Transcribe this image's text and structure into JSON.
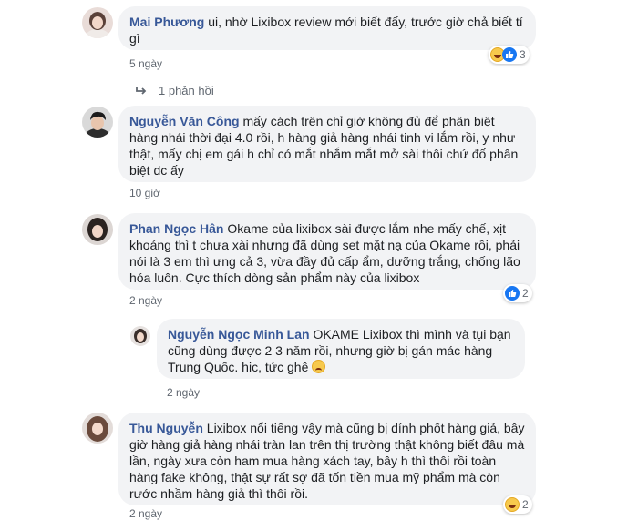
{
  "comments": [
    {
      "author": "Mai Phương",
      "text": "ui, nhờ Lixibox review mới biết đấy, trước giờ chả biết tí gì",
      "time": "5 ngày",
      "reaction_count": "3",
      "reactions": [
        "haha",
        "like"
      ]
    },
    {
      "author": "Nguyễn Văn Công",
      "text": "mấy cách trên chỉ giờ không đủ để phân biệt hàng nhái thời đại 4.0 rồi, h hàng giả hàng nhái tinh vi lắm rồi, y như thật, mấy chị em gái h chỉ có mắt nhắm mắt mở sài thôi chứ đố phân biệt dc ấy",
      "time": "10 giờ"
    },
    {
      "author": "Phan Ngọc Hân",
      "text": "Okame của lixibox sài được lắm nhe mấy chế, xịt khoáng thì t chưa xài nhưng đã dùng set mặt nạ của Okame rồi, phải nói là 3 em thì ưng cả 3, vừa đầy đủ cấp ẩm, dưỡng trắng, chống lão hóa luôn. Cực thích dòng sản phẩm này của lixibox",
      "time": "2 ngày",
      "reaction_count": "2",
      "reactions": [
        "like"
      ]
    },
    {
      "author": "Nguyễn Ngọc Minh Lan",
      "text": "OKAME Lixibox thì mình và tụi bạn cũng dùng được 2 3 năm rồi, nhưng giờ bị gán mác hàng Trung Quốc. hic, tức ghê",
      "time": "2 ngày",
      "emoji": "sad"
    },
    {
      "author": "Thu Nguyễn",
      "text": "Lixibox nổi tiếng vậy mà cũng bị dính phốt hàng giả, bây giờ hàng giả hàng nhái tràn lan trên thị trường thật không biết đâu mà lần, ngày xưa còn ham mua hàng xách tay, bây h thì thôi rồi toàn hàng fake không, thật sự rất sợ đã tốn tiền mua mỹ phẩm mà còn rước nhầm hàng giả thì thôi rồi.",
      "time": "2 ngày",
      "reaction_count": "2",
      "reactions": [
        "haha"
      ]
    }
  ],
  "replies_link": "1 phản hồi",
  "colors": {
    "author": "#385898",
    "bubble": "#f2f3f5",
    "meta": "#606770",
    "like": "#1877f2",
    "haha": "#f7c94d"
  }
}
